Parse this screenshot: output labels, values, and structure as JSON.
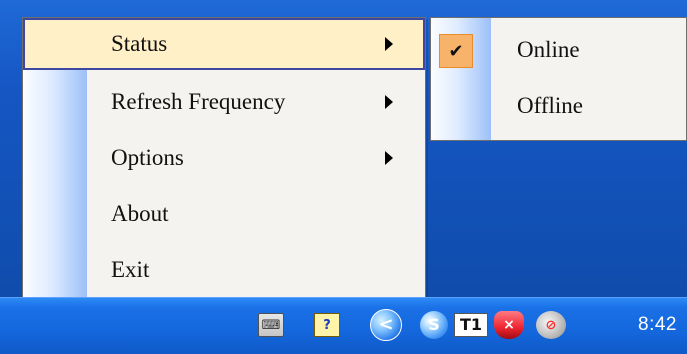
{
  "menu": {
    "items": [
      {
        "label": "Status",
        "has_submenu": true,
        "active": true
      },
      {
        "label": "Refresh Frequency",
        "has_submenu": true,
        "active": false
      },
      {
        "label": "Options",
        "has_submenu": true,
        "active": false
      },
      {
        "label": "About",
        "has_submenu": false,
        "active": false
      },
      {
        "label": "Exit",
        "has_submenu": false,
        "active": false
      }
    ]
  },
  "submenu": {
    "items": [
      {
        "label": "Online",
        "checked": true,
        "check_icon": "checkmark-icon",
        "check_glyph": "✔"
      },
      {
        "label": "Offline",
        "checked": false
      }
    ]
  },
  "taskbar": {
    "clock": "8:42",
    "icons": [
      {
        "name": "keyboard-icon",
        "glyph": "⌨"
      },
      {
        "name": "help-icon",
        "glyph": "?"
      },
      {
        "name": "chevron-left-icon",
        "glyph": "<"
      },
      {
        "name": "s-icon",
        "glyph": "S"
      },
      {
        "name": "t1-icon",
        "glyph": "T1"
      },
      {
        "name": "shield-icon",
        "glyph": "×"
      },
      {
        "name": "network-icon",
        "glyph": "⊘"
      }
    ]
  },
  "colors": {
    "desktop": "#1556c3",
    "taskbar": "#1467dc",
    "menu_background": "#f4f3ef",
    "active_item": "#fff0c8",
    "active_border": "#3f48a0",
    "check_background": "#f8b36a"
  }
}
